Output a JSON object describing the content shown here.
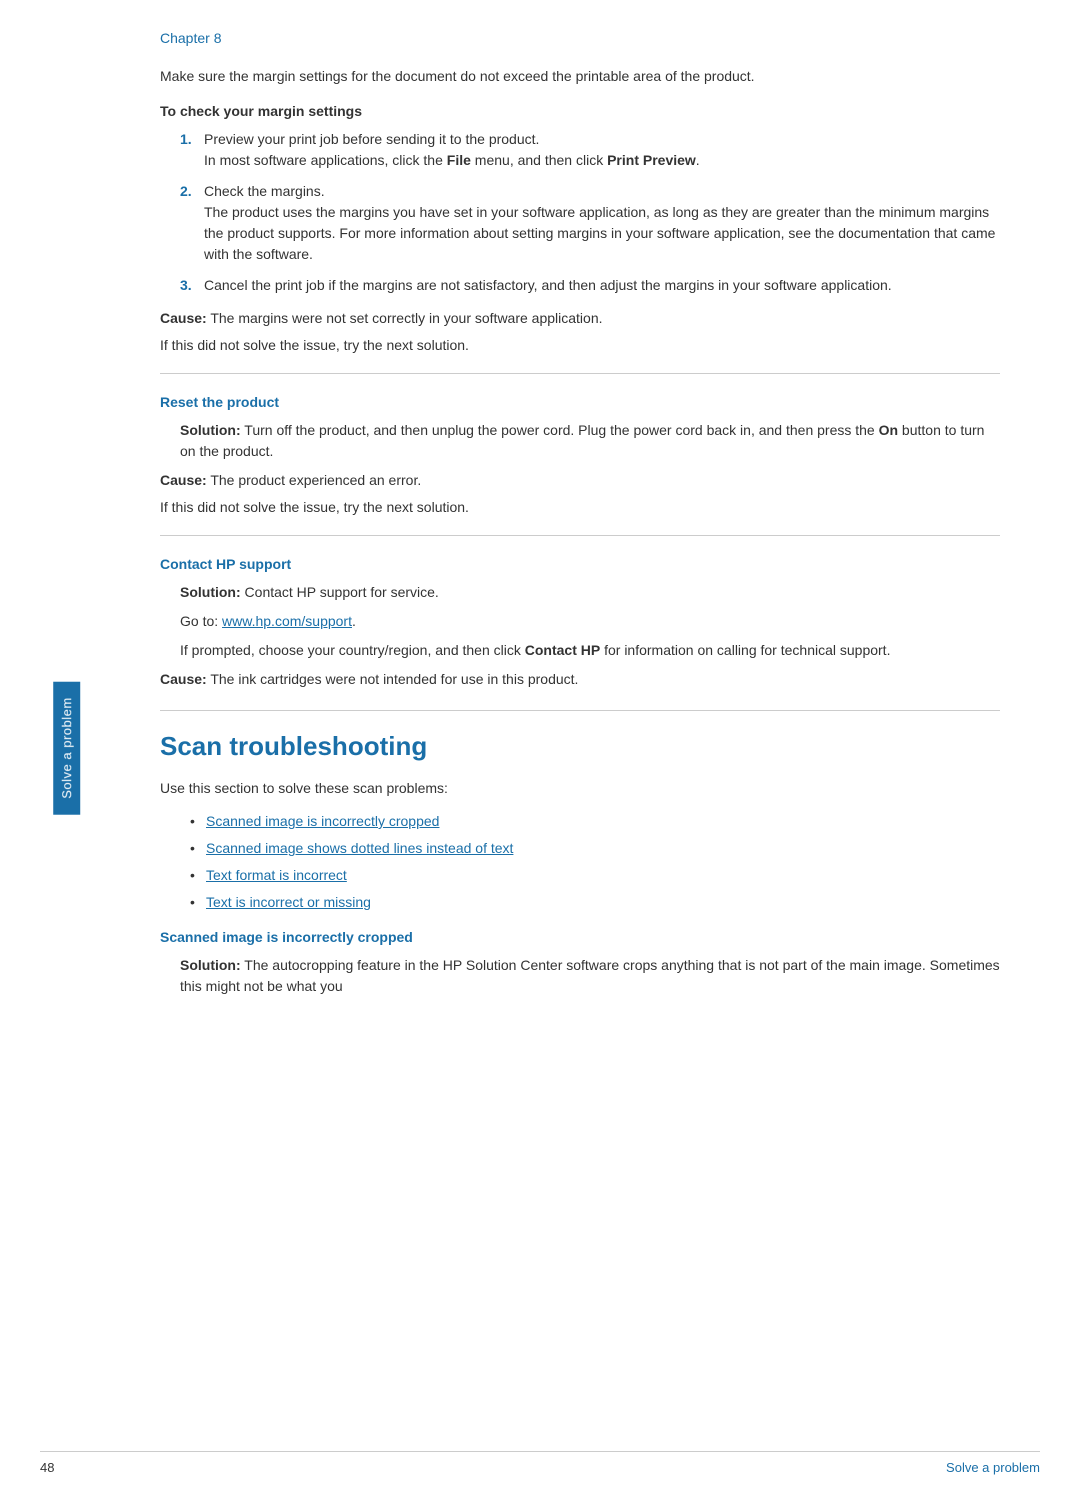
{
  "side_tab": {
    "label": "Solve a problem"
  },
  "chapter": {
    "label": "Chapter 8"
  },
  "intro": {
    "text": "Make sure the margin settings for the document do not exceed the printable area of the product."
  },
  "margin_section": {
    "heading": "To check your margin settings",
    "steps": [
      {
        "number": "1.",
        "text": "Preview your print job before sending it to the product.",
        "sub": "In most software applications, click the File menu, and then click Print Preview."
      },
      {
        "number": "2.",
        "text": "Check the margins.",
        "sub": "The product uses the margins you have set in your software application, as long as they are greater than the minimum margins the product supports. For more information about setting margins in your software application, see the documentation that came with the software."
      },
      {
        "number": "3.",
        "text": "Cancel the print job if the margins are not satisfactory, and then adjust the margins in your software application.",
        "sub": ""
      }
    ],
    "cause": "The margins were not set correctly in your software application.",
    "next_solution": "If this did not solve the issue, try the next solution."
  },
  "reset_section": {
    "heading": "Reset the product",
    "solution": "Turn off the product, and then unplug the power cord. Plug the power cord back in, and then press the On button to turn on the product.",
    "cause": "The product experienced an error.",
    "next_solution": "If this did not solve the issue, try the next solution."
  },
  "contact_section": {
    "heading": "Contact HP support",
    "solution": "Contact HP support for service.",
    "go_to_text": "Go to:",
    "go_to_link": "www.hp.com/support",
    "go_to_href": "http://www.hp.com/support",
    "prompted_text": "If prompted, choose your country/region, and then click Contact HP for information on calling for technical support.",
    "cause": "The ink cartridges were not intended for use in this product."
  },
  "scan_section": {
    "heading": "Scan troubleshooting",
    "intro": "Use this section to solve these scan problems:",
    "links": [
      {
        "label": "Scanned image is incorrectly cropped"
      },
      {
        "label": "Scanned image shows dotted lines instead of text"
      },
      {
        "label": "Text format is incorrect"
      },
      {
        "label": "Text is incorrect or missing"
      }
    ],
    "cropped_heading": "Scanned image is incorrectly cropped",
    "cropped_solution": "The autocropping feature in the HP Solution Center software crops anything that is not part of the main image. Sometimes this might not be what you"
  },
  "footer": {
    "page_number": "48",
    "label": "Solve a problem"
  }
}
